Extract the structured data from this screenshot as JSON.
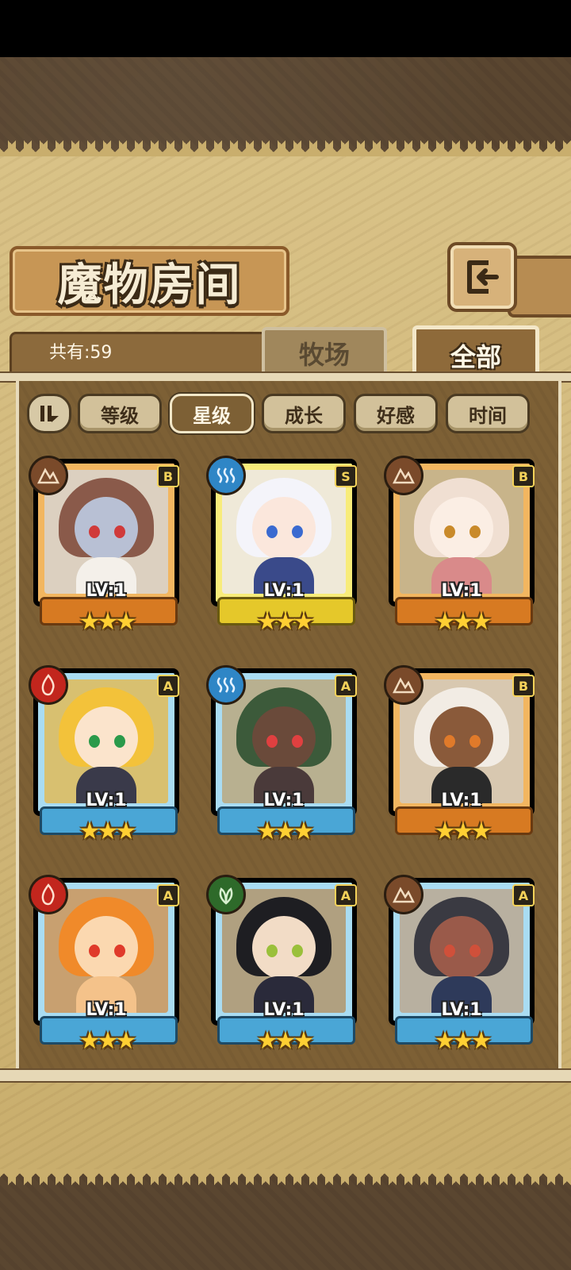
{
  "header": {
    "title": "魔物房间",
    "back_icon": "back-arrow-icon"
  },
  "summary": {
    "count_text": "共有:59"
  },
  "tabs": [
    {
      "label": "牧场",
      "active": false
    },
    {
      "label": "全部",
      "active": true
    }
  ],
  "filters": [
    {
      "label": "等级",
      "active": false
    },
    {
      "label": "星级",
      "active": true
    },
    {
      "label": "成长",
      "active": false
    },
    {
      "label": "好感",
      "active": false
    },
    {
      "label": "时间",
      "active": false
    }
  ],
  "monsters": [
    {
      "grade": "B",
      "element": "earth",
      "level": "LV:1",
      "stars": 3
    },
    {
      "grade": "S",
      "element": "water",
      "level": "LV:1",
      "stars": 3
    },
    {
      "grade": "B",
      "element": "earth",
      "level": "LV:1",
      "stars": 3
    },
    {
      "grade": "A",
      "element": "fire",
      "level": "LV:1",
      "stars": 3
    },
    {
      "grade": "A",
      "element": "water",
      "level": "LV:1",
      "stars": 3
    },
    {
      "grade": "B",
      "element": "earth",
      "level": "LV:1",
      "stars": 3
    },
    {
      "grade": "A",
      "element": "fire",
      "level": "LV:1",
      "stars": 3
    },
    {
      "grade": "A",
      "element": "wood",
      "level": "LV:1",
      "stars": 3
    },
    {
      "grade": "A",
      "element": "earth",
      "level": "LV:1",
      "stars": 3
    }
  ],
  "colors": {
    "grade_B": "#e28a2a",
    "grade_S": "#f1d933",
    "grade_A": "#5ab5e2",
    "element_earth": "#7a4a2a",
    "element_water": "#2f86c6",
    "element_fire": "#c2261d",
    "element_wood": "#2e6a2a"
  }
}
